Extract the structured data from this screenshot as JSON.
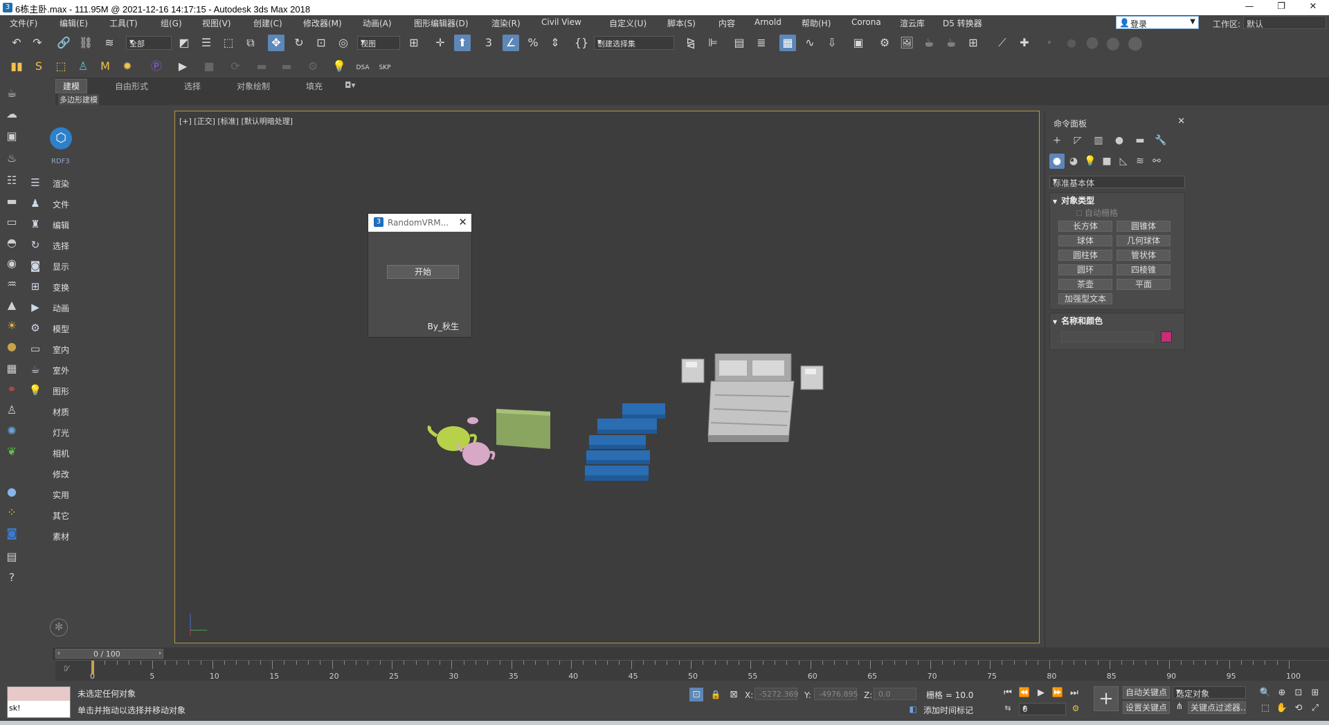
{
  "window": {
    "title": "6栋主卧.max - 111.95M @ 2021-12-16 14:17:15 - Autodesk 3ds Max 2018",
    "app_icon": "3",
    "minimize": "—",
    "restore": "❐",
    "close": "✕"
  },
  "menu": {
    "items": [
      "文件(F)",
      "编辑(E)",
      "工具(T)",
      "组(G)",
      "视图(V)",
      "创建(C)",
      "修改器(M)",
      "动画(A)",
      "图形编辑器(D)",
      "渲染(R)",
      "Civil View",
      "自定义(U)",
      "脚本(S)",
      "内容",
      "Arnold",
      "帮助(H)",
      "Corona",
      "渲云库",
      "D5 转换器"
    ],
    "login": "登录",
    "workspace_label": "工作区:",
    "workspace_value": "默认"
  },
  "toolbar": {
    "selection_filter": "全部",
    "ref_coord": "视图",
    "named_selection": "创建选择集",
    "label_3": "3",
    "label_dsa": "DSA",
    "label_skp": "SKP"
  },
  "ribbon": {
    "tabs": [
      "建模",
      "自由形式",
      "选择",
      "对象绘制",
      "填充"
    ],
    "subtab": "多边形建模"
  },
  "script_panel": {
    "logo_label": "RDF3",
    "items": [
      "渲染",
      "文件",
      "编辑",
      "选择",
      "显示",
      "变换",
      "动画",
      "模型",
      "室内",
      "室外",
      "图形",
      "材质",
      "灯光",
      "相机",
      "修改",
      "实用",
      "其它",
      "素材"
    ]
  },
  "viewport": {
    "label": "[+] [正交] [标准] [默认明暗处理]"
  },
  "dialog": {
    "title": "RandomVRM...",
    "start_button": "开始",
    "footer": "By_秋生",
    "close": "✕"
  },
  "command_panel": {
    "title": "命令面板",
    "close": "✕",
    "category": "标准基本体",
    "object_type_header": "对象类型",
    "auto_grid": "自动栅格",
    "primitives": [
      "长方体",
      "圆锥体",
      "球体",
      "几何球体",
      "圆柱体",
      "管状体",
      "圆环",
      "四棱锥",
      "茶壶",
      "平面",
      "加强型文本"
    ],
    "name_color_header": "名称和颜色",
    "object_color": "#c62e77"
  },
  "timeline": {
    "frame_display": "0 / 100",
    "current_frame": 0,
    "total_frames": 100,
    "tick_labels": [
      "0",
      "5",
      "10",
      "15",
      "20",
      "25",
      "30",
      "35",
      "40",
      "45",
      "50",
      "55",
      "60",
      "65",
      "70",
      "75",
      "80",
      "85",
      "90",
      "95",
      "100"
    ]
  },
  "status": {
    "maxscript_text": "sk!",
    "line1": "未选定任何对象",
    "line2": "单击并拖动以选择并移动对象",
    "x_label": "X:",
    "x_value": "-5272.369",
    "y_label": "Y:",
    "y_value": "-4976.895",
    "z_label": "Z:",
    "z_value": "0.0",
    "grid": "栅格 = 10.0",
    "add_time_tag": "添加时间标记",
    "auto_key": "自动关键点",
    "selected_object": "选定对象",
    "set_key": "设置关键点",
    "key_filters": "关键点过滤器...",
    "frame_field": "0"
  }
}
